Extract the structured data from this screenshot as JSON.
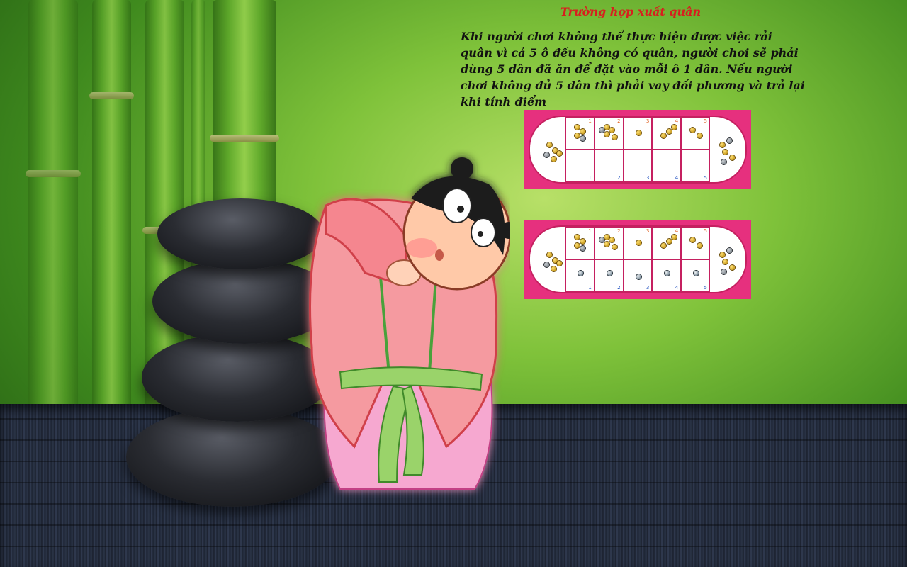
{
  "title": "Trường hợp xuất quân",
  "description": "Khi người chơi không thể thực hiện được việc rải quân vì cả 5 ô đều không có quân, người chơi sẽ phải dùng 5 dân đã ăn để đặt vào mỗi ô 1 dân. Nếu người chơi không đủ 5 dân thì phải vay đối phương và trả lại khi tính điểm",
  "boards": [
    {
      "top_numbers": [
        "1",
        "2",
        "3",
        "4",
        "5"
      ],
      "bottom_numbers": [
        "1",
        "2",
        "3",
        "4",
        "5"
      ]
    },
    {
      "top_numbers": [
        "1",
        "2",
        "3",
        "4",
        "5"
      ],
      "bottom_numbers": [
        "1",
        "2",
        "3",
        "4",
        "5"
      ]
    }
  ],
  "colors": {
    "title": "#d81e1e",
    "board_frame": "#e6307e",
    "text": "#111111"
  },
  "illustration": {
    "character": "cartoon-girl-bowing-icon",
    "stones": "stacked-black-stones-icon",
    "background": "bamboo-forest"
  }
}
